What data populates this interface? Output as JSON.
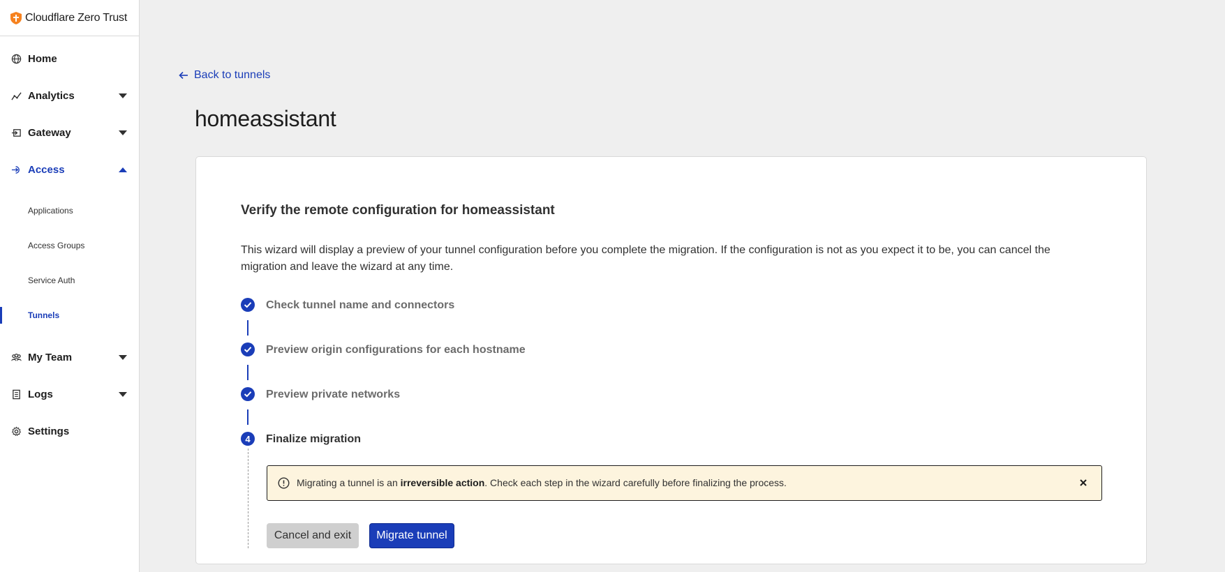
{
  "brand": {
    "name": "Cloudflare Zero Trust"
  },
  "sidebar": {
    "items": [
      {
        "label": "Home",
        "icon": "globe-icon"
      },
      {
        "label": "Analytics",
        "icon": "analytics-icon"
      },
      {
        "label": "Gateway",
        "icon": "gateway-icon"
      },
      {
        "label": "Access",
        "icon": "access-icon"
      },
      {
        "label": "My Team",
        "icon": "team-icon"
      },
      {
        "label": "Logs",
        "icon": "logs-icon"
      },
      {
        "label": "Settings",
        "icon": "gear-icon"
      }
    ],
    "access_sub": [
      {
        "label": "Applications"
      },
      {
        "label": "Access Groups"
      },
      {
        "label": "Service Auth"
      },
      {
        "label": "Tunnels"
      }
    ]
  },
  "main": {
    "back_link": "Back to tunnels",
    "title": "homeassistant"
  },
  "wizard": {
    "heading": "Verify the remote configuration for homeassistant",
    "description": "This wizard will display a preview of your tunnel configuration before you complete the migration. If the configuration is not as you expect it to be, you can cancel the migration and leave the wizard at any time.",
    "steps": [
      {
        "label": "Check tunnel name and connectors",
        "status": "done"
      },
      {
        "label": "Preview origin configurations for each hostname",
        "status": "done"
      },
      {
        "label": "Preview private networks",
        "status": "done"
      },
      {
        "label": "Finalize migration",
        "status": "current",
        "number": "4"
      }
    ],
    "alert": {
      "before": "Migrating a tunnel is an ",
      "bold": "irreversible action",
      "after": ". Check each step in the wizard carefully before finalizing the process."
    },
    "cancel_label": "Cancel and exit",
    "migrate_label": "Migrate tunnel"
  },
  "colors": {
    "accent": "#1a3db8",
    "warning_bg": "#fdf4de",
    "brand_orange": "#f6821f"
  }
}
